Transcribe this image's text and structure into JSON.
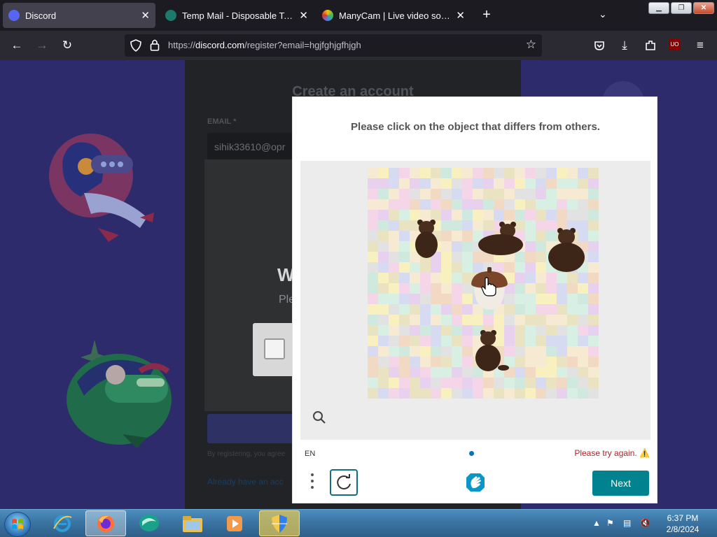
{
  "browser": {
    "tabs": [
      {
        "title": "Discord",
        "active": true
      },
      {
        "title": "Temp Mail - Disposable Tempo"
      },
      {
        "title": "ManyCam | Live video software"
      }
    ],
    "new_tab": "+",
    "url_domain": "discord.com",
    "url_prefix": "https://",
    "url_path": "/register?email=hgjfghjgfhjgh"
  },
  "page": {
    "title": "Create an account",
    "email_label": "EMAIL *",
    "email_value": "sihik33610@opr",
    "captcha_title": "W",
    "captcha_sub": "Ple",
    "fineprint": "By registering, you agree",
    "login_link": "Already have an acc"
  },
  "captcha": {
    "prompt": "Please click on the object that differs from others.",
    "language": "EN",
    "error": "Please try again. ⚠️",
    "next_label": "Next"
  },
  "taskbar": {
    "time": "6:37 PM",
    "date": "2/8/2024"
  },
  "colors": {
    "accent": "#00838f",
    "error": "#a8262b",
    "discord_bg": "#2d2b6b"
  }
}
